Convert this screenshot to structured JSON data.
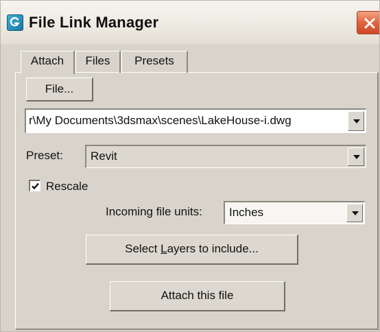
{
  "window": {
    "title": "File Link Manager",
    "close_icon": "close-icon",
    "app_icon": "3dsmax-app-icon"
  },
  "tabs": [
    {
      "label": "Attach",
      "active": true
    },
    {
      "label": "Files",
      "active": false
    },
    {
      "label": "Presets",
      "active": false
    }
  ],
  "attach": {
    "file_button": "File...",
    "file_path": "r\\My Documents\\3dsmax\\scenes\\LakeHouse-i.dwg",
    "preset_label": "Preset:",
    "preset_value": "Revit",
    "rescale_label": "Rescale",
    "rescale_checked": true,
    "units_label": "Incoming file units:",
    "units_value": "Inches",
    "select_layers_pre": "Select ",
    "select_layers_mnemonic": "L",
    "select_layers_post": "ayers to include...",
    "attach_button": "Attach this file"
  },
  "colors": {
    "dialog_bg": "#d8d4cb",
    "close_red": "#e0643f",
    "app_icon_blue": "#1977a6"
  }
}
